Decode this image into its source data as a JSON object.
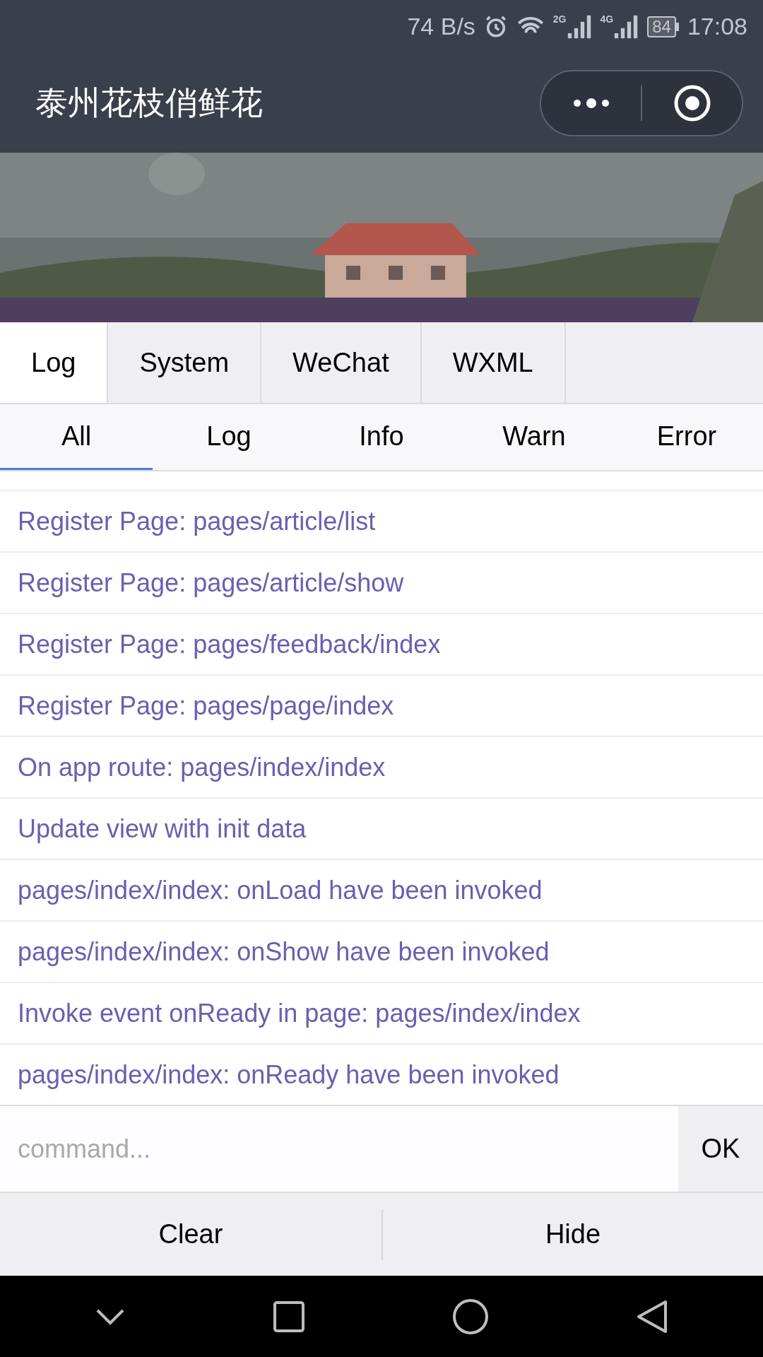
{
  "status_bar": {
    "speed": "74 B/s",
    "signal_1": "2G",
    "signal_2": "4G",
    "battery": "84",
    "time": "17:08"
  },
  "header": {
    "title": "泰州花枝俏鲜花"
  },
  "tabs": [
    {
      "label": "Log",
      "selected": true
    },
    {
      "label": "System",
      "selected": false
    },
    {
      "label": "WeChat",
      "selected": false
    },
    {
      "label": "WXML",
      "selected": false
    }
  ],
  "filters": [
    {
      "label": "All",
      "selected": true
    },
    {
      "label": "Log",
      "selected": false
    },
    {
      "label": "Info",
      "selected": false
    },
    {
      "label": "Warn",
      "selected": false
    },
    {
      "label": "Error",
      "selected": false
    }
  ],
  "log": [
    "Register Page: pages/article/list",
    "Register Page: pages/article/show",
    "Register Page: pages/feedback/index",
    "Register Page: pages/page/index",
    "On app route: pages/index/index",
    "Update view with init data",
    "pages/index/index: onLoad have been invoked",
    "pages/index/index: onShow have been invoked",
    "Invoke event onReady in page: pages/index/index",
    "pages/index/index: onReady have been invoked"
  ],
  "command": {
    "placeholder": "command...",
    "submit": "OK"
  },
  "actions": [
    "Clear",
    "Hide"
  ]
}
